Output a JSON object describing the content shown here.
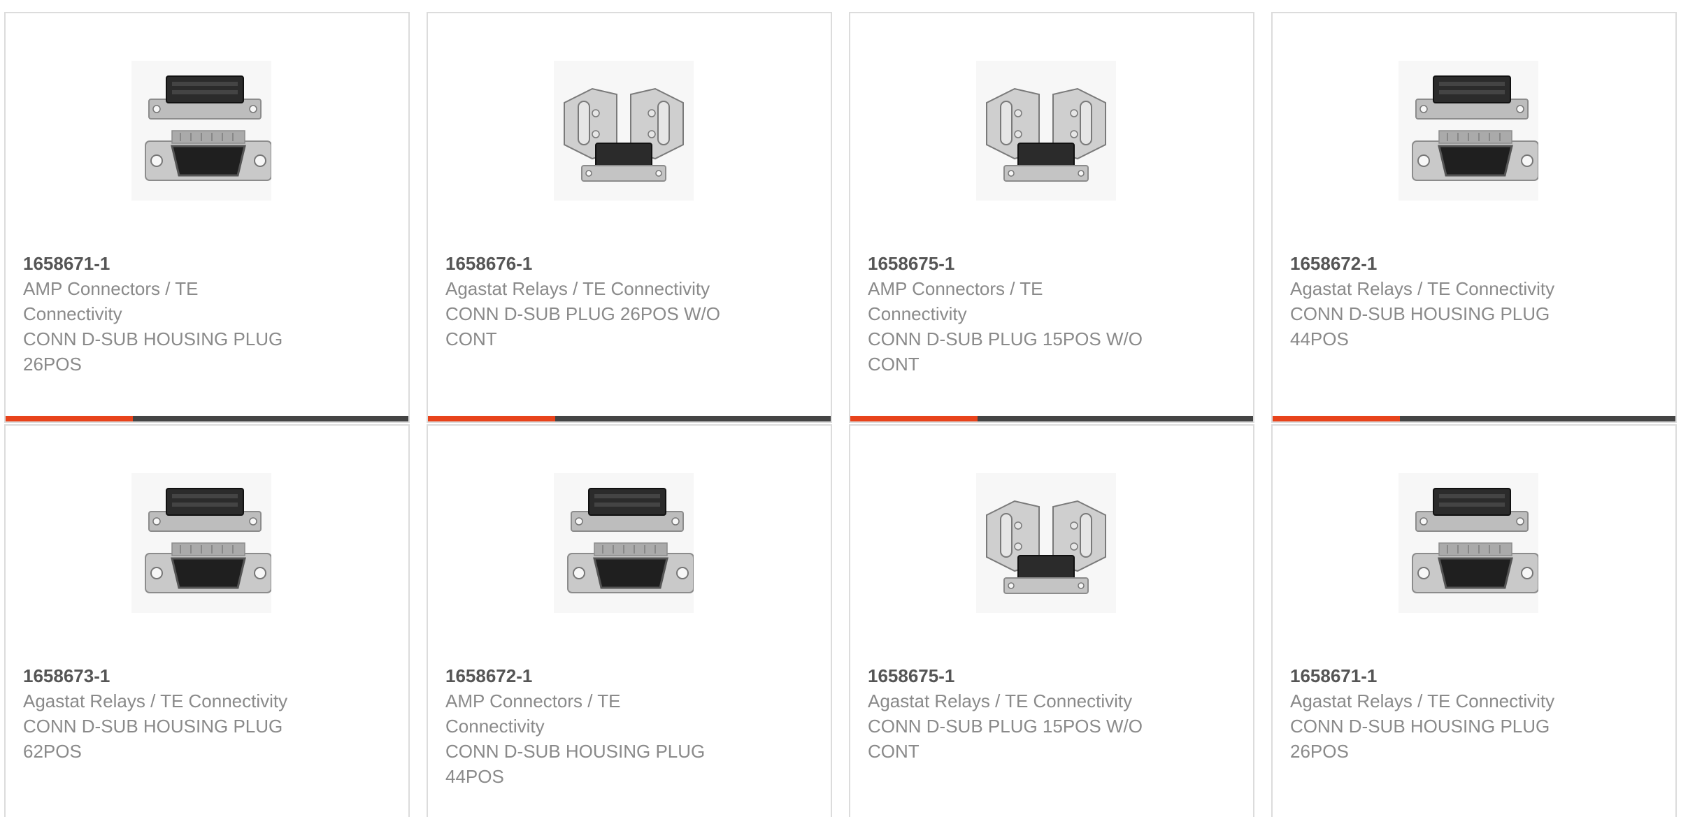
{
  "products": [
    {
      "part_number": "1658671-1",
      "manufacturer": "AMP Connectors / TE Connectivity",
      "description": "CONN D-SUB HOUSING PLUG 26POS",
      "image": "dsub-plug-with-housing-image"
    },
    {
      "part_number": "1658676-1",
      "manufacturer": "Agastat Relays / TE Connectivity",
      "description": "CONN D-SUB PLUG 26POS W/O CONT",
      "image": "dsub-backshell-kit-image"
    },
    {
      "part_number": "1658675-1",
      "manufacturer": "AMP Connectors / TE Connectivity",
      "description": "CONN D-SUB PLUG 15POS W/O CONT",
      "image": "dsub-backshell-kit-image"
    },
    {
      "part_number": "1658672-1",
      "manufacturer": "Agastat Relays / TE Connectivity",
      "description": "CONN D-SUB HOUSING PLUG 44POS",
      "image": "dsub-plug-with-housing-image"
    },
    {
      "part_number": "1658673-1",
      "manufacturer": "Agastat Relays / TE Connectivity",
      "description": "CONN D-SUB HOUSING PLUG 62POS",
      "image": "dsub-plug-with-housing-image"
    },
    {
      "part_number": "1658672-1",
      "manufacturer": "AMP Connectors / TE Connectivity",
      "description": "CONN D-SUB HOUSING PLUG 44POS",
      "image": "dsub-plug-with-housing-image"
    },
    {
      "part_number": "1658675-1",
      "manufacturer": "Agastat Relays / TE Connectivity",
      "description": "CONN D-SUB PLUG 15POS W/O CONT",
      "image": "dsub-backshell-kit-image"
    },
    {
      "part_number": "1658671-1",
      "manufacturer": "Agastat Relays / TE Connectivity",
      "description": "CONN D-SUB HOUSING PLUG 26POS",
      "image": "dsub-plug-with-housing-image"
    }
  ],
  "colors": {
    "accent": "#e8431b",
    "bar": "#444444",
    "border": "#dcdcdc",
    "part_number_text": "#555555",
    "secondary_text": "#8a8a8a"
  }
}
